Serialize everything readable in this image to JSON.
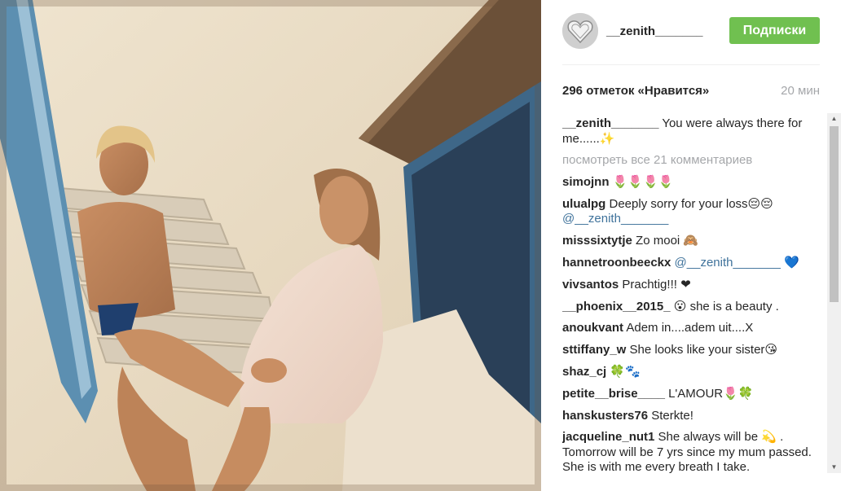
{
  "header": {
    "username": "__zenith_______",
    "follow_label": "Подписки"
  },
  "stats": {
    "likes": "296 отметок «Нравится»",
    "time": "20 мин"
  },
  "caption": {
    "user": "__zenith_______",
    "text": " You were always there for me......✨"
  },
  "load_more": "посмотреть все 21 комментариев",
  "comments": [
    {
      "user": "simojnn",
      "text": " 🌷🌷🌷🌷"
    },
    {
      "user": "ulualpg",
      "text": " Deeply sorry for your loss😔😔 ",
      "mention": "@__zenith_______"
    },
    {
      "user": "misssixtytje",
      "text": " Zo mooi 🙈"
    },
    {
      "user": "hannetroonbeeckx",
      "text": " ",
      "mention": "@__zenith_______",
      "suffix": " 💙"
    },
    {
      "user": "vivsantos",
      "text": " Prachtig!!! ❤"
    },
    {
      "user": "__phoenix__2015_",
      "text": " 😮 she is a beauty ."
    },
    {
      "user": "anoukvant",
      "text": " Adem in....adem uit....X"
    },
    {
      "user": "sttiffany_w",
      "text": " She looks like your sister😘"
    },
    {
      "user": "shaz_cj",
      "text": " 🍀🐾"
    },
    {
      "user": "petite__brise____",
      "text": " L'AMOUR🌷🍀"
    },
    {
      "user": "hanskusters76",
      "text": " Sterkte!"
    },
    {
      "user": "jacqueline_nut1",
      "text": " She always will be 💫 . Tomorrow will be 7 yrs since my mum passed. She is with me every breath I take."
    }
  ]
}
